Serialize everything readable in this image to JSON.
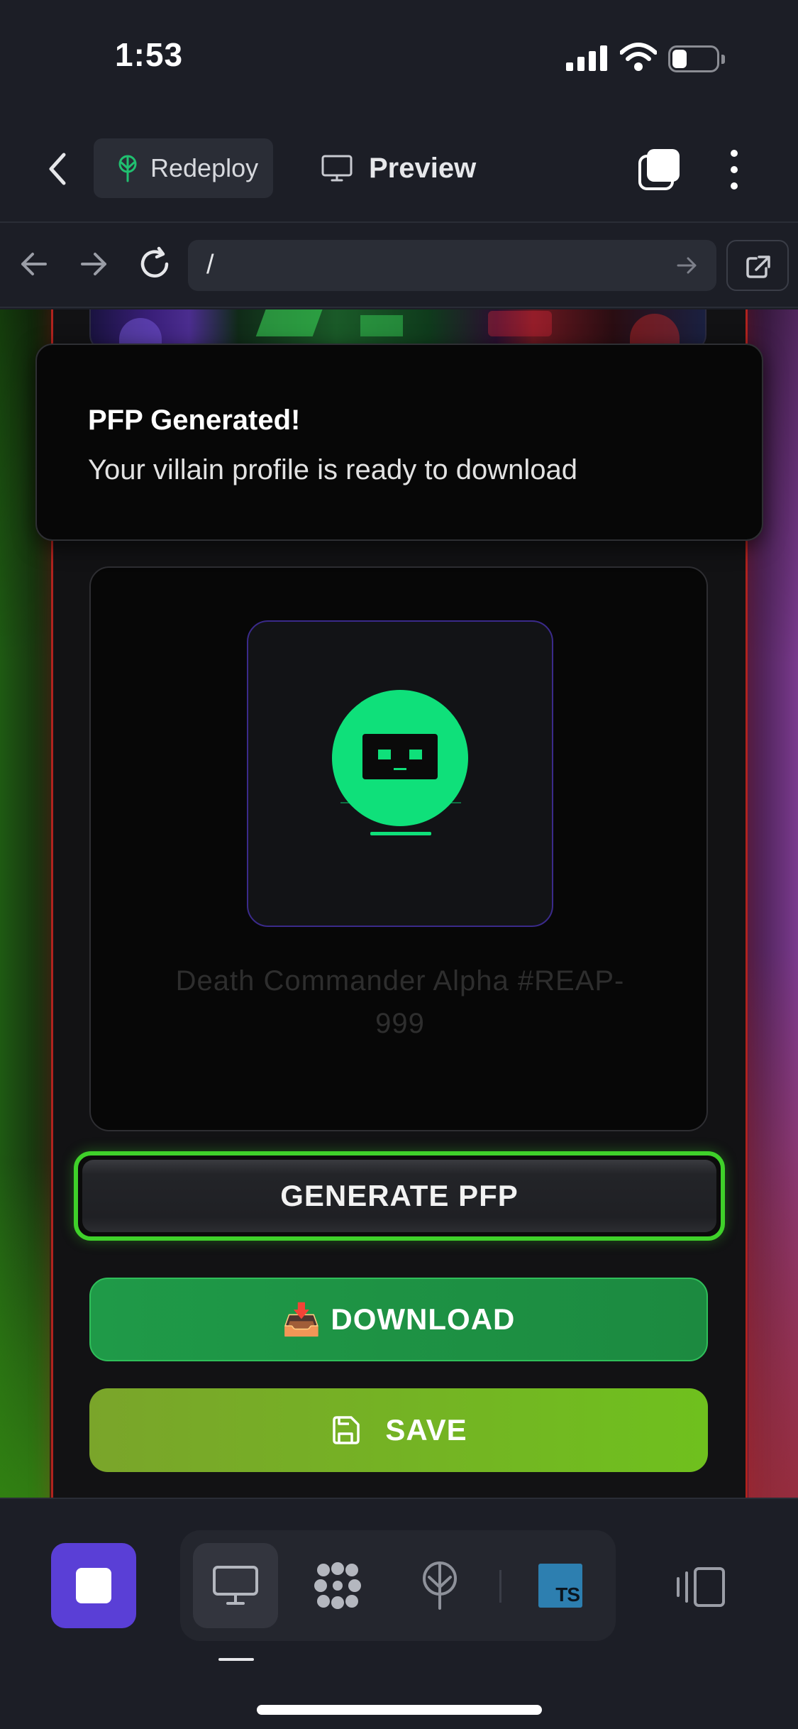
{
  "status_bar": {
    "time": "1:53",
    "icons": [
      "cellular-signal-icon",
      "wifi-icon",
      "battery-icon"
    ]
  },
  "header": {
    "back_icon": "chevron-left-icon",
    "redeploy_label": "Redeploy",
    "redeploy_icon": "deploy-tree-icon",
    "preview_label": "Preview",
    "preview_icon": "monitor-icon",
    "tabs_icon": "tabs-icon",
    "more_icon": "more-vertical-icon"
  },
  "browser": {
    "back_icon": "arrow-left-icon",
    "forward_icon": "arrow-right-icon",
    "reload_icon": "reload-icon",
    "url": "/",
    "go_icon": "arrow-right-icon",
    "open_external_icon": "external-link-icon"
  },
  "toast": {
    "title": "PFP Generated!",
    "message": "Your villain profile is ready to download"
  },
  "pfp_card": {
    "name_line1": "Death Commander Alpha #REAP-",
    "name_line2": "999",
    "avatar_color": "#0fe07a",
    "avatar_border_color": "#3a2a8a"
  },
  "actions": {
    "generate_label": "GENERATE PFP",
    "download_icon": "📥",
    "download_label": "DOWNLOAD",
    "save_icon": "save-disk-icon",
    "save_label": "SAVE"
  },
  "colors": {
    "app_bg": "#1c1e26",
    "accent_purple": "#5a3fd6",
    "generate_border": "#3fd12a",
    "download_bg": "#1f9a48",
    "save_bg": "#6fc01e",
    "frame_border": "#b0231e"
  },
  "bottom_bar": {
    "stop_icon": "stop-icon",
    "tools": [
      "monitor-icon",
      "modules-icon",
      "deploy-tree-icon",
      "typescript-icon"
    ],
    "ts_badge": "TS",
    "panel_icon": "panel-layout-icon"
  }
}
